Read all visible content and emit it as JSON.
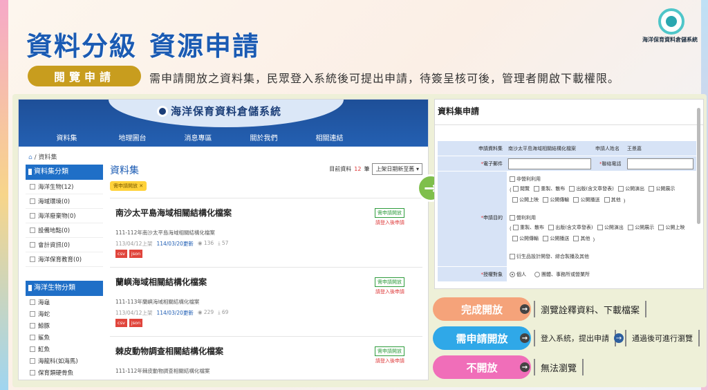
{
  "heading": {
    "part1": "資料分級",
    "part2": "資源申請"
  },
  "logo": {
    "text": "海洋保育資料倉儲系統"
  },
  "pill": {
    "label": "閱覽申請"
  },
  "subtitle": "需申請開放之資料集，民眾登入系統後可提出申請，待簽呈核可後，管理者開啟下載權限。",
  "site": {
    "brand": "海洋保育資料倉儲系統",
    "nav": [
      "資料集",
      "地理圖台",
      "消息專區",
      "關於我們",
      "相關連結"
    ],
    "breadcrumb": "/ 資料集",
    "category_head": "資料集分類",
    "categories": [
      "海洋生物(12)",
      "海域環境(0)",
      "海洋廢棄物(0)",
      "設備地點(0)",
      "會計資訊(0)",
      "海洋保育教育(0)"
    ],
    "bio_head": "海洋生物分類",
    "bio_items": [
      "海龜",
      "海蛇",
      "鯨豚",
      "鯊魚",
      "魟魚",
      "海龍科(如海馬)",
      "保育類硬骨魚"
    ],
    "main_title": "資料集",
    "sort_prefix": "目前資料",
    "sort_count": "12",
    "sort_suffix": "筆",
    "sort_select": "上架日期新至舊",
    "filter_tag": "需申請開放 ✕",
    "records": [
      {
        "title": "南沙太平島海域相關結構化檔案",
        "desc": "111-112年南沙太平島海域相關結構化檔案",
        "created": "113/04/12上架",
        "updated": "114/03/20更新",
        "views": "136",
        "downloads": "57",
        "formats": [
          "csv",
          "json"
        ],
        "badge": "需申請開放",
        "login": "請登入後申請"
      },
      {
        "title": "蘭嶼海域相關結構化檔案",
        "desc": "111-113年蘭嶼海域相關結構化檔案",
        "created": "113/04/12上架",
        "updated": "114/03/20更新",
        "views": "229",
        "downloads": "69",
        "formats": [
          "csv",
          "json"
        ],
        "badge": "需申請開放",
        "login": "請登入後申請"
      },
      {
        "title": "棘皮動物調查相關結構化檔案",
        "desc": "111-112年棘皮動物調查相關結構化檔案",
        "badge": "需申請開放",
        "login": "請登入後申請"
      }
    ]
  },
  "form": {
    "title": "資料集申請",
    "dataset_label": "申請資料集",
    "dataset_value": "南沙太平島海域相關結構化檔案",
    "applicant_label": "申請人姓名",
    "applicant_value": "王景嘉",
    "email_label": "電子郵件",
    "phone_label": "聯絡電話",
    "purpose_label": "申請目的",
    "noncommercial": "非營利利用",
    "noncommercial_opts_1": [
      "閱覽",
      "重製、散布",
      "出版(含文章發表)",
      "公開演出",
      "公開展示"
    ],
    "noncommercial_opts_2": [
      "公開上映",
      "公開傳輸",
      "公開播送",
      "其他"
    ],
    "commercial": "營利利用",
    "commercial_opts_1": [
      "重製、散布",
      "出版(含文章發表)",
      "公開演出",
      "公開展示",
      "公開上映"
    ],
    "commercial_opts_2": [
      "公開傳輸",
      "公開播送",
      "其他"
    ],
    "derivative": "衍生品設計開發、綜合製播及其他",
    "target_label": "授權對象",
    "target_opts": [
      "個人",
      "團體、事務所或營業所"
    ]
  },
  "legend": [
    {
      "label": "完成開放",
      "color": "#f5a37a",
      "desc": "瀏覽詮釋資料、下載檔案"
    },
    {
      "label": "需申請開放",
      "color": "#2fa8e8",
      "desc": "登入系統，提出申請",
      "desc2": "通過後可進行瀏覽"
    },
    {
      "label": "不開放",
      "color": "#f06eb9",
      "desc": "無法瀏覽"
    }
  ],
  "icons": {
    "arrow": "→"
  }
}
